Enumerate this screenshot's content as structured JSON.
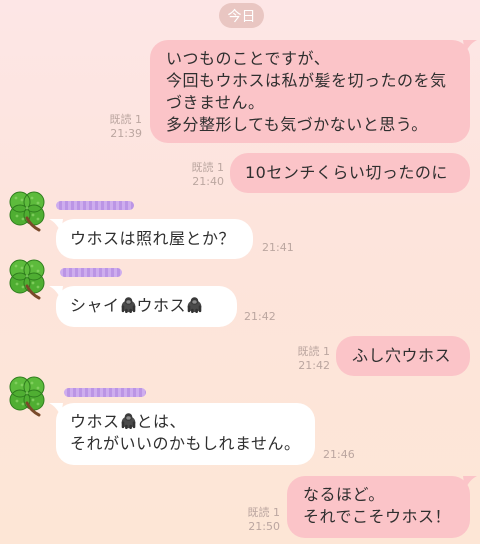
{
  "date_label": "今日",
  "messages": [
    {
      "id": "m1",
      "side": "me",
      "read": "既読 1",
      "time": "21:39",
      "lines": [
        "いつものことですが、",
        "今回もウホスは私が髪を切ったのを気",
        "づきません。",
        "多分整形しても気づかないと思う。"
      ]
    },
    {
      "id": "m2",
      "side": "me",
      "read": "既読 1",
      "time": "21:40",
      "lines": [
        "10センチくらい切ったのに"
      ]
    },
    {
      "id": "m3",
      "side": "them",
      "time": "21:41",
      "lines": [
        "ウホスは照れ屋とか？"
      ]
    },
    {
      "id": "m4",
      "side": "them",
      "time": "21:42",
      "parts": [
        "シャイ",
        "ウホス"
      ]
    },
    {
      "id": "m5",
      "side": "me",
      "read": "既読 1",
      "time": "21:42",
      "lines": [
        "ふし穴ウホス"
      ]
    },
    {
      "id": "m6",
      "side": "them",
      "time": "21:46",
      "line1_parts": [
        "ウホス",
        "とは、"
      ],
      "lines": [
        "それがいいのかもしれません。"
      ]
    },
    {
      "id": "m7",
      "side": "me",
      "read": "既読 1",
      "time": "21:50",
      "lines": [
        "なるほど。",
        "それでこそウホス！"
      ]
    }
  ],
  "colors": {
    "my_bubble": "#fbc4c8",
    "their_bubble": "#ffffff",
    "meta_text": "#bba6a0",
    "date_pill": "#e9c6c2"
  },
  "icons": {
    "avatar": "clover-avatar-icon",
    "emoji": "gorilla-icon"
  }
}
